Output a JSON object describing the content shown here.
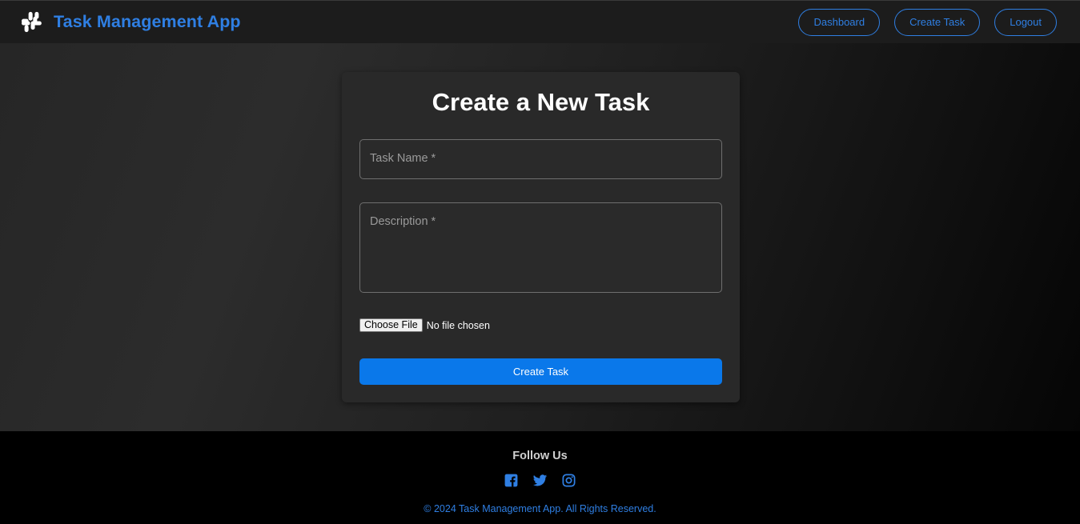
{
  "header": {
    "title": "Task Management App",
    "logo_icon": "slack-logo-icon",
    "nav": [
      {
        "label": "Dashboard"
      },
      {
        "label": "Create Task"
      },
      {
        "label": "Logout"
      }
    ]
  },
  "form": {
    "title": "Create a New Task",
    "task_name": {
      "placeholder": "Task Name *",
      "value": ""
    },
    "description": {
      "placeholder": "Description *",
      "value": ""
    },
    "file": {
      "button_label": "Choose File",
      "status": "No file chosen"
    },
    "submit_label": "Create Task"
  },
  "footer": {
    "heading": "Follow Us",
    "social": [
      "facebook-icon",
      "twitter-icon",
      "instagram-icon"
    ],
    "copyright": "© 2024 Task Management App. All Rights Reserved."
  },
  "colors": {
    "accent": "#2f7fe3",
    "primary_button": "#0a78ea",
    "card": "#292929",
    "navbar": "#1c1c1c",
    "footer": "#000000"
  }
}
